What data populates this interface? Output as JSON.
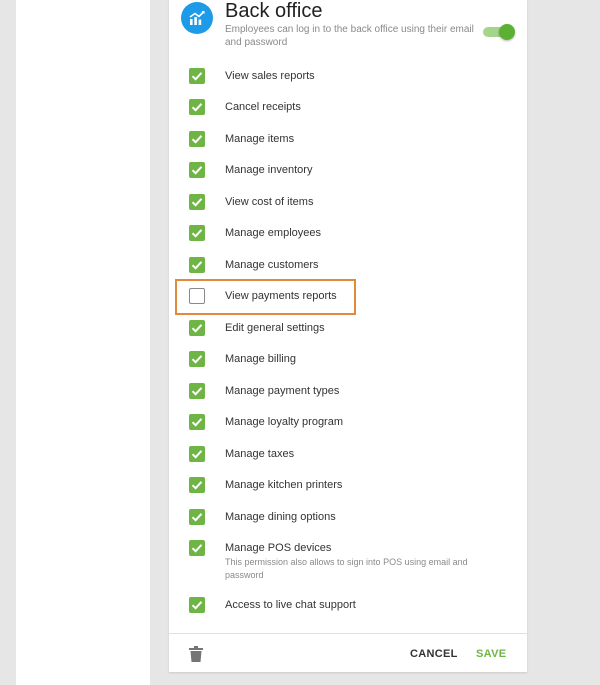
{
  "header": {
    "title": "Back office",
    "subtitle": "Employees can log in to the back office using their email and password",
    "toggle_on": true
  },
  "permissions": [
    {
      "label": "View sales reports",
      "checked": true
    },
    {
      "label": "Cancel receipts",
      "checked": true
    },
    {
      "label": "Manage items",
      "checked": true
    },
    {
      "label": "Manage inventory",
      "checked": true
    },
    {
      "label": "View cost of items",
      "checked": true
    },
    {
      "label": "Manage employees",
      "checked": true
    },
    {
      "label": "Manage customers",
      "checked": true
    },
    {
      "label": "View payments reports",
      "checked": false
    },
    {
      "label": "Edit general settings",
      "checked": true
    },
    {
      "label": "Manage billing",
      "checked": true
    },
    {
      "label": "Manage payment types",
      "checked": true
    },
    {
      "label": "Manage loyalty program",
      "checked": true
    },
    {
      "label": "Manage taxes",
      "checked": true
    },
    {
      "label": "Manage kitchen printers",
      "checked": true
    },
    {
      "label": "Manage dining options",
      "checked": true
    },
    {
      "label": "Manage POS devices",
      "checked": true,
      "description": "This permission also allows to sign into POS using email and password"
    },
    {
      "label": "Access to live chat support",
      "checked": true
    }
  ],
  "footer": {
    "cancel_label": "CANCEL",
    "save_label": "SAVE"
  },
  "icons": {
    "app": "chart-icon",
    "delete": "trash-icon",
    "check": "check-icon"
  },
  "colors": {
    "accent_green": "#6fb545",
    "app_icon_blue": "#1e9be8",
    "highlight_orange": "#e08a3a"
  }
}
